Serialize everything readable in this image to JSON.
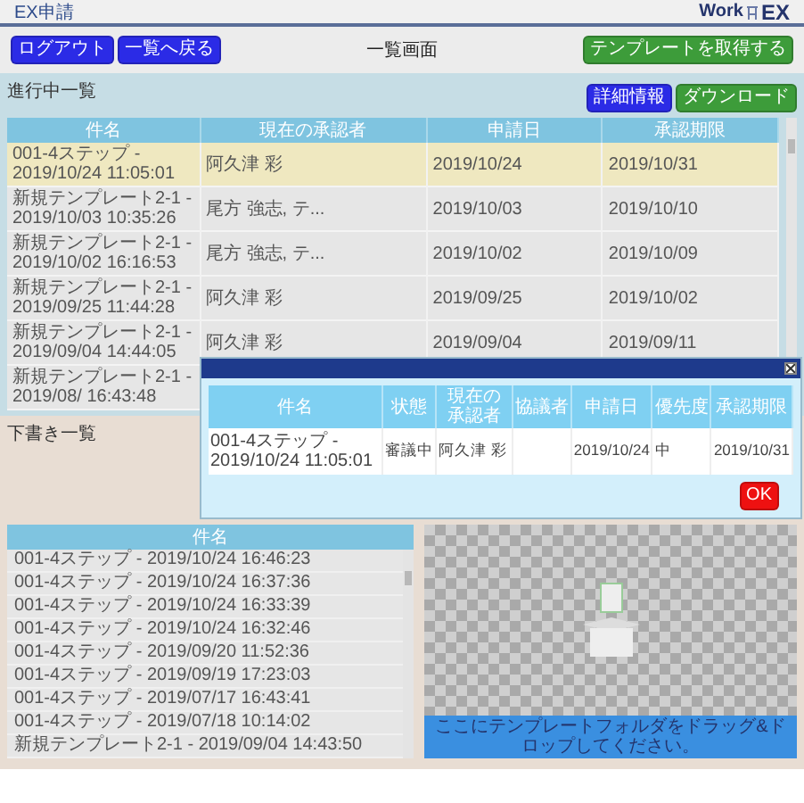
{
  "app": {
    "title": "EX申請",
    "logo_left": "Work",
    "logo_right": "EX"
  },
  "toolbar": {
    "buttons": [
      {
        "label": "ログアウト",
        "kind": "primary"
      },
      {
        "label": "一覧へ戻る",
        "kind": "primary"
      }
    ],
    "title": "一覧画面",
    "action": {
      "label": "テンプレートを取得する",
      "kind": "success"
    }
  },
  "in_progress": {
    "title": "進行中一覧",
    "buttons": [
      {
        "label": "詳細情報",
        "kind": "primary"
      },
      {
        "label": "ダウンロード",
        "kind": "success"
      }
    ],
    "table": {
      "columns": [
        "件名",
        "現在の承認者",
        "申請日",
        "承認期限"
      ],
      "rows": [
        {
          "selected": true,
          "cells": [
            "001-4ステップ - 2019/10/24 11:05:01",
            "阿久津 彩",
            "2019/10/24",
            "2019/10/31"
          ]
        },
        {
          "selected": false,
          "cells": [
            "新規テンプレート2-1 - 2019/10/03 10:35:26",
            "尾方 強志, テ...",
            "2019/10/03",
            "2019/10/10"
          ]
        },
        {
          "selected": false,
          "cells": [
            "新規テンプレート2-1 - 2019/10/02 16:16:53",
            "尾方 強志, テ...",
            "2019/10/02",
            "2019/10/09"
          ]
        },
        {
          "selected": false,
          "cells": [
            "新規テンプレート2-1 - 2019/09/25 11:44:28",
            "阿久津 彩",
            "2019/09/25",
            "2019/10/02"
          ]
        },
        {
          "selected": false,
          "cells": [
            "新規テンプレート2-1 - 2019/09/04 14:44:05",
            "阿久津 彩",
            "2019/09/04",
            "2019/09/11"
          ]
        },
        {
          "selected": false,
          "cells": [
            "新規テンプレート2-1 - 2019/08/ 16:43:48"
          ]
        }
      ]
    }
  },
  "dialog": {
    "columns": [
      "件名",
      "状態",
      "現在の承認者",
      "協議者",
      "申請日",
      "優先度",
      "承認期限"
    ],
    "rows": [
      [
        "001-4ステップ - 2019/10/24 11:05:01",
        "審議中",
        "阿久津 彩",
        "",
        "2019/10/24",
        "中",
        "2019/10/31"
      ]
    ],
    "ok": {
      "label": "OK",
      "kind": "danger"
    }
  },
  "drafts": {
    "title": "下書き一覧",
    "column": "件名",
    "items": [
      "001-4ステップ - 2019/10/24 16:46:23",
      "001-4ステップ - 2019/10/24 16:37:36",
      "001-4ステップ - 2019/10/24 16:33:39",
      "001-4ステップ - 2019/10/24 16:32:46",
      "001-4ステップ - 2019/09/20 11:52:36",
      "001-4ステップ - 2019/09/19 17:23:03",
      "001-4ステップ - 2019/07/17 16:43:41",
      "001-4ステップ - 2019/07/18 10:14:02",
      "新規テンプレート2-1 - 2019/09/04 14:43:50"
    ]
  },
  "dropzone": {
    "hint": "ここにテンプレートフォルダをドラッグ&ドロップしてください。"
  }
}
